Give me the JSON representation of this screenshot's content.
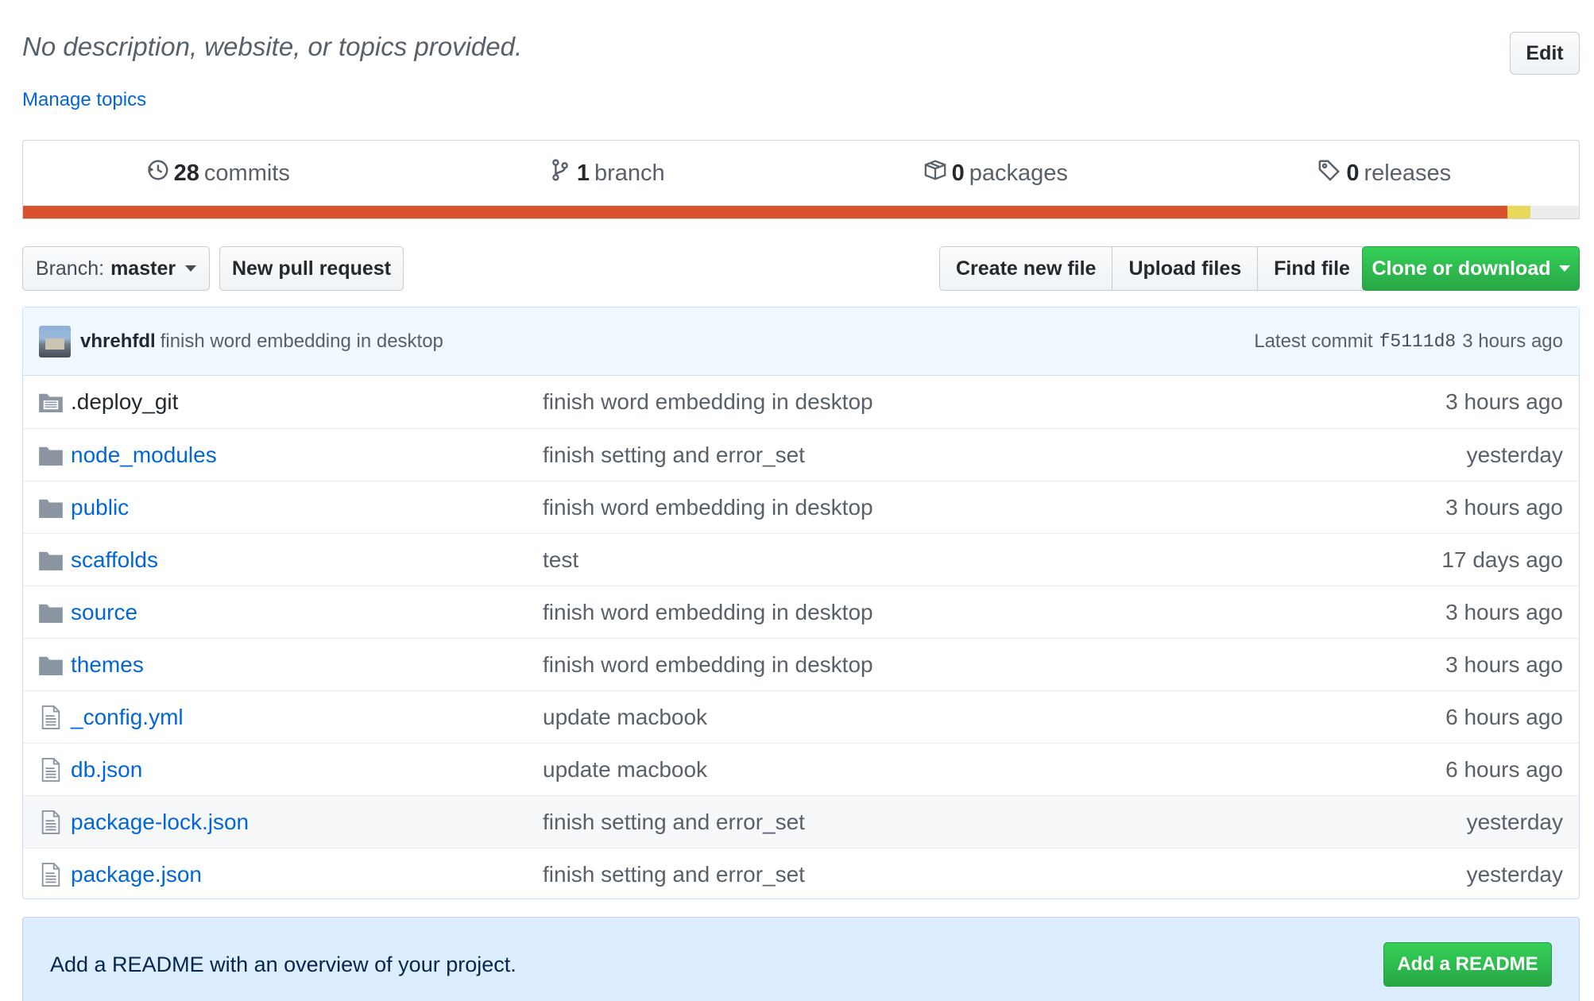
{
  "description": {
    "text": "No description, website, or topics provided.",
    "edit_label": "Edit",
    "manage_topics_label": "Manage topics"
  },
  "summary": {
    "commits": {
      "count": "28",
      "label": "commits",
      "icon": "history-icon"
    },
    "branches": {
      "count": "1",
      "label": "branch",
      "icon": "git-branch-icon"
    },
    "packages": {
      "count": "0",
      "label": "packages",
      "icon": "package-icon"
    },
    "releases": {
      "count": "0",
      "label": "releases",
      "icon": "tag-icon"
    },
    "language_bar": {
      "colors": [
        "#d9512d",
        "#e8d95d",
        "#ededed"
      ]
    }
  },
  "toolbar": {
    "branch_prefix": "Branch:",
    "branch_name": "master",
    "new_pr_label": "New pull request",
    "create_file_label": "Create new file",
    "upload_files_label": "Upload files",
    "find_file_label": "Find file",
    "clone_label": "Clone or download"
  },
  "latest_commit": {
    "author": "vhrehfdl",
    "message": "finish word embedding in desktop",
    "prefix": "Latest commit",
    "sha": "f5111d8",
    "age": "3 hours ago"
  },
  "files": [
    {
      "name": ".deploy_git",
      "type": "submodule",
      "message": "finish word embedding in desktop",
      "age": "3 hours ago"
    },
    {
      "name": "node_modules",
      "type": "folder",
      "message": "finish setting and error_set",
      "age": "yesterday"
    },
    {
      "name": "public",
      "type": "folder",
      "message": "finish word embedding in desktop",
      "age": "3 hours ago"
    },
    {
      "name": "scaffolds",
      "type": "folder",
      "message": "test",
      "age": "17 days ago"
    },
    {
      "name": "source",
      "type": "folder",
      "message": "finish word embedding in desktop",
      "age": "3 hours ago"
    },
    {
      "name": "themes",
      "type": "folder",
      "message": "finish word embedding in desktop",
      "age": "3 hours ago"
    },
    {
      "name": "_config.yml",
      "type": "file",
      "message": "update macbook",
      "age": "6 hours ago"
    },
    {
      "name": "db.json",
      "type": "file",
      "message": "update macbook",
      "age": "6 hours ago"
    },
    {
      "name": "package-lock.json",
      "type": "file",
      "message": "finish setting and error_set",
      "age": "yesterday"
    },
    {
      "name": "package.json",
      "type": "file",
      "message": "finish setting and error_set",
      "age": "yesterday"
    }
  ],
  "readme_prompt": {
    "text": "Add a README with an overview of your project.",
    "button_label": "Add a README"
  }
}
